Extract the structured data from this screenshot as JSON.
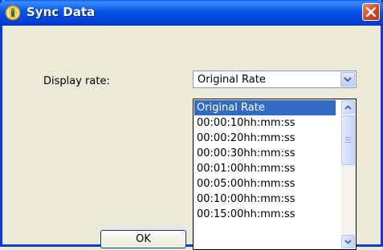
{
  "window": {
    "title": "Sync Data",
    "app_icon": "antenna-icon",
    "close_icon": "close-icon"
  },
  "form": {
    "display_rate_label": "Display rate:",
    "display_rate_value": "Original Rate"
  },
  "dropdown": {
    "options": [
      "Original Rate",
      "00:00:10hh:mm:ss",
      "00:00:20hh:mm:ss",
      "00:00:30hh:mm:ss",
      "00:01:00hh:mm:ss",
      "00:05:00hh:mm:ss",
      "00:10:00hh:mm:ss",
      "00:15:00hh:mm:ss"
    ],
    "selected_index": 0
  },
  "buttons": {
    "ok_label": "OK"
  },
  "colors": {
    "titlebar": "#0553E6",
    "selection": "#316AC5",
    "dialog_background": "#ECE9D8",
    "close_button": "#D2471F"
  }
}
